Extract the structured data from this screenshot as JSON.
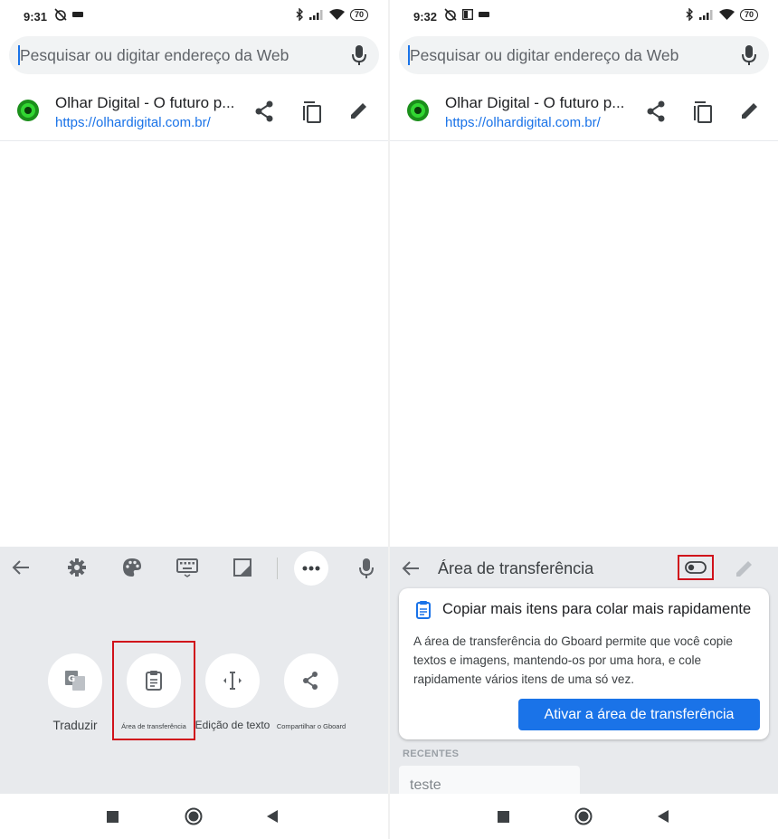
{
  "left": {
    "status": {
      "time": "9:31",
      "battery": "70"
    },
    "search": {
      "placeholder": "Pesquisar ou digitar endereço da Web"
    },
    "suggestion": {
      "title": "Olhar Digital - O futuro p...",
      "url": "https://olhardigital.com.br/"
    },
    "toolbar": {
      "icons": [
        "back-arrow-icon",
        "gear-icon",
        "palette-icon",
        "keyboard-icon",
        "resize-icon",
        "more-dots-icon",
        "mic-icon"
      ]
    },
    "features": [
      {
        "label": "Traduzir",
        "icon": "translate-icon"
      },
      {
        "label": "Área de transferência",
        "icon": "clipboard-icon"
      },
      {
        "label": "Edição de texto",
        "icon": "text-cursor-icon"
      },
      {
        "label": "Compartilhar o Gboard",
        "icon": "share-icon"
      }
    ]
  },
  "right": {
    "status": {
      "time": "9:32",
      "battery": "70"
    },
    "search": {
      "placeholder": "Pesquisar ou digitar endereço da Web"
    },
    "suggestion": {
      "title": "Olhar Digital - O futuro p...",
      "url": "https://olhardigital.com.br/"
    },
    "clipboard": {
      "title": "Área de transferência",
      "card_title": "Copiar mais itens para colar mais rapidamente",
      "card_body": "A área de transferência do Gboard permite que você copie textos e imagens, mantendo-os por uma hora, e cole rapidamente vários itens de uma só vez.",
      "button_label": "Ativar a área de transferência",
      "recent_header": "RECENTES",
      "items": [
        "teste"
      ]
    }
  },
  "colors": {
    "accent": "#1a73e8",
    "highlight": "#d0121b",
    "keyboard_bg": "#e8eaed"
  }
}
